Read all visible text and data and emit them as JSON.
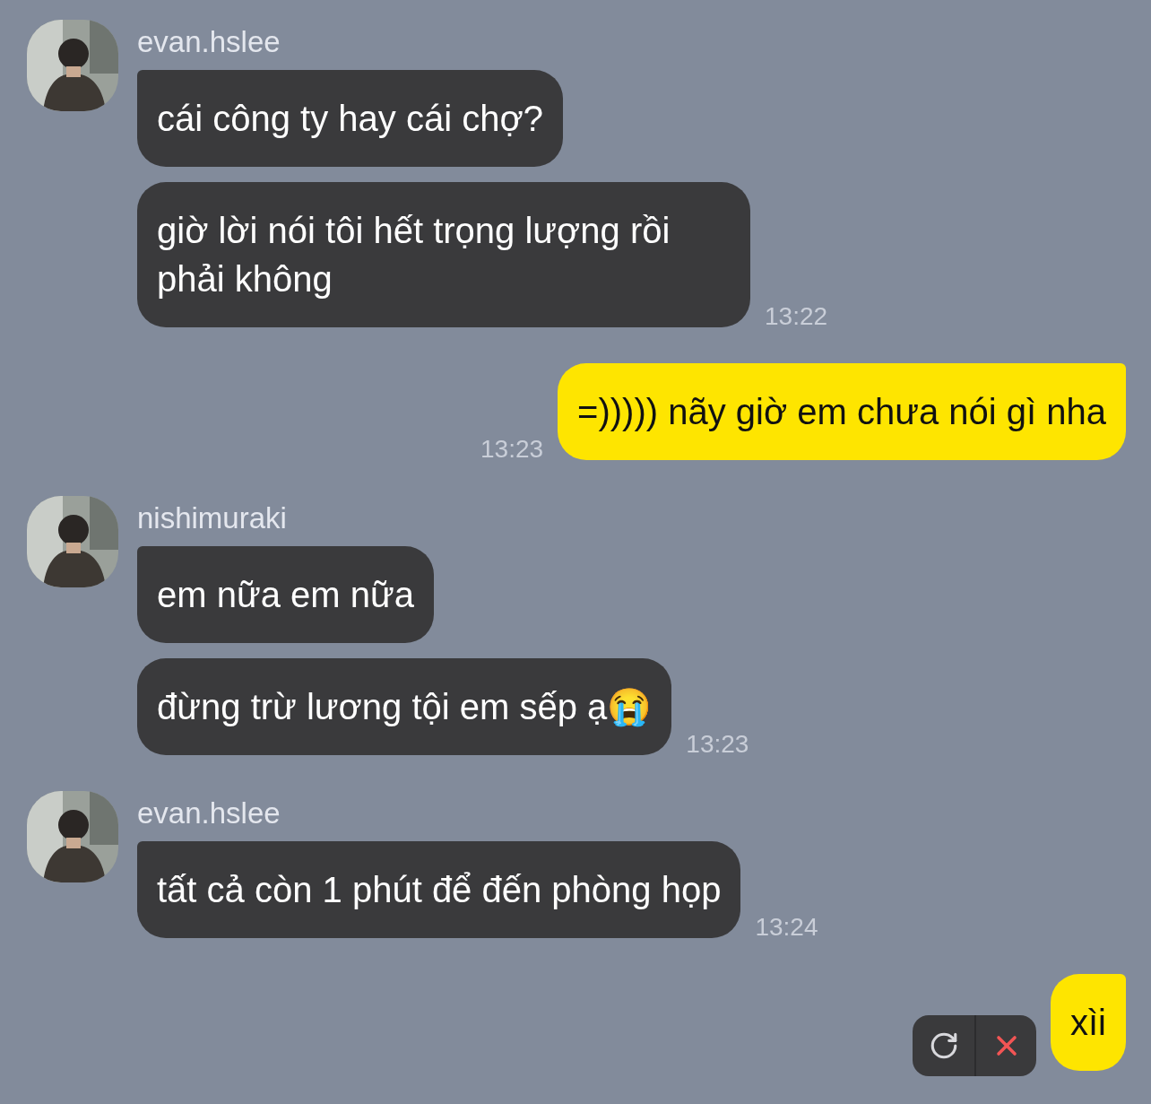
{
  "groups": [
    {
      "kind": "incoming",
      "sender": "evan.hslee",
      "avatar": {
        "kind": "picture"
      },
      "messages": [
        {
          "text": "cái công ty hay cái chợ?"
        },
        {
          "text": "giờ lời nói tôi hết trọng lượng rồi phải không",
          "time": "13:22"
        }
      ]
    },
    {
      "kind": "outgoing",
      "messages": [
        {
          "text": "=))))) nãy giờ em chưa nói gì nha",
          "time": "13:23"
        }
      ]
    },
    {
      "kind": "incoming",
      "sender": "nishimuraki",
      "avatar": {
        "kind": "picture"
      },
      "messages": [
        {
          "text": "em nữa em nữa"
        },
        {
          "text": "đừng trừ lương tội em sếp ạ😭",
          "time": "13:23"
        }
      ]
    },
    {
      "kind": "incoming",
      "sender": "evan.hslee",
      "avatar": {
        "kind": "picture"
      },
      "messages": [
        {
          "text": "tất cả còn 1 phút để đến phòng họp",
          "time": "13:24"
        }
      ]
    },
    {
      "kind": "outgoing",
      "messages": [
        {
          "text": "xìi",
          "failed": true
        }
      ]
    }
  ]
}
